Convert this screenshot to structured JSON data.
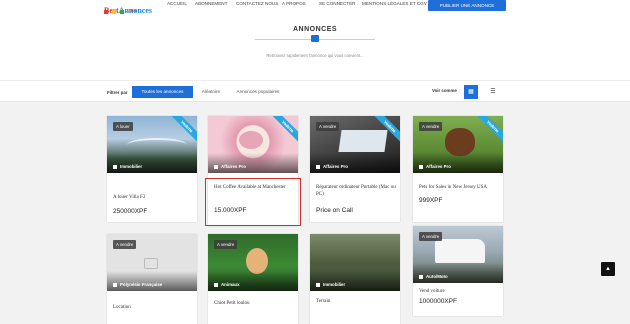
{
  "header": {
    "logo_brand": "Best",
    "logo_brand2": "Annonces",
    "logo_sub": ".com",
    "nav": [
      "ACCUEIL",
      "ABONNEMENT",
      "CONTACTEZ NOUS",
      "A PROPOS",
      "SE CONNECTER",
      "MENTIONS LÉGALES ET CGV"
    ],
    "publish_label": "PUBLIER UNE ANNONCE"
  },
  "hero": {
    "title": "ANNONCES",
    "subtitle": "Retrouvez rapidement l'annonce qui vous convient..."
  },
  "filters": {
    "label": "Filtrer par",
    "options": [
      "Toutes les annonces",
      "Aléatoire",
      "Annonces populaires"
    ],
    "view_label": "Voir comme"
  },
  "colors": {
    "accent": "#1e6fd9",
    "ribbon": "#29a8e0",
    "highlight": "#d32f2f"
  },
  "cards": [
    {
      "tag": "A louer",
      "category": "Immobilier",
      "ribbon": "Vedette",
      "title": "A louer Villa F3",
      "price": "250000XPF",
      "icon": "building-icon"
    },
    {
      "tag": "",
      "category": "Affaires Pro",
      "ribbon": "Vedette",
      "title": "Hot Coffee Available at Manchester",
      "price": "15.000XPF",
      "icon": "briefcase-icon"
    },
    {
      "tag": "A vendre",
      "category": "Affaires Pro",
      "ribbon": "Vedette",
      "title": "Réparateur ordinateur Portable (Mac ou PC)",
      "price": "Price on Call",
      "icon": "briefcase-icon"
    },
    {
      "tag": "A vendre",
      "category": "Affaires Pro",
      "ribbon": "Vedette",
      "title": "Pets for Sales in New Jersey USA",
      "price": "999XPF",
      "icon": "briefcase-icon"
    },
    {
      "tag": "A vendre",
      "category": "Polynésie Française",
      "ribbon": "",
      "title": "Location",
      "price": "",
      "icon": "plane-icon"
    },
    {
      "tag": "A vendre",
      "category": "Animaux",
      "ribbon": "",
      "title": "Chiot Petit loulou",
      "price": "",
      "icon": "paw-icon"
    },
    {
      "tag": "",
      "category": "Immobilier",
      "ribbon": "",
      "title": "Terrain",
      "price": "",
      "icon": "building-icon"
    },
    {
      "tag": "A vendre",
      "category": "Auto/Moto",
      "ribbon": "",
      "title": "Vend voiture",
      "price": "1000000XPF",
      "icon": "car-icon"
    }
  ]
}
